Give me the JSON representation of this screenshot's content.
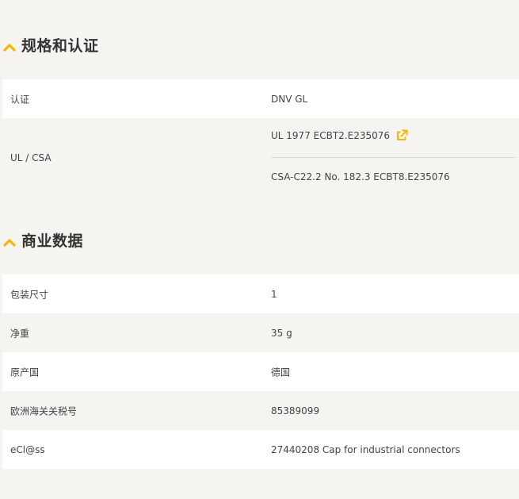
{
  "sections": {
    "specs": {
      "title": "规格和认证",
      "rows": {
        "certification": {
          "label": "认证",
          "value": "DNV GL"
        },
        "ul_csa": {
          "label": "UL / CSA",
          "values": [
            "UL 1977 ECBT2.E235076",
            "CSA-C22.2 No. 182.3 ECBT8.E235076"
          ]
        }
      }
    },
    "commercial": {
      "title": "商业数据",
      "rows": [
        {
          "label": "包装尺寸",
          "value": "1"
        },
        {
          "label": "净重",
          "value": "35 g"
        },
        {
          "label": "原产国",
          "value": "德国"
        },
        {
          "label": "欧洲海关关税号",
          "value": "85389099"
        },
        {
          "label": "eCl@ss",
          "value": "27440208 Cap for industrial connectors"
        }
      ]
    }
  },
  "icons": {
    "chevron": "chevron-up-icon",
    "external_link": "external-link-icon"
  },
  "colors": {
    "accent": "#f2b705",
    "background": "#f5f4f0",
    "row_white": "#ffffff"
  }
}
